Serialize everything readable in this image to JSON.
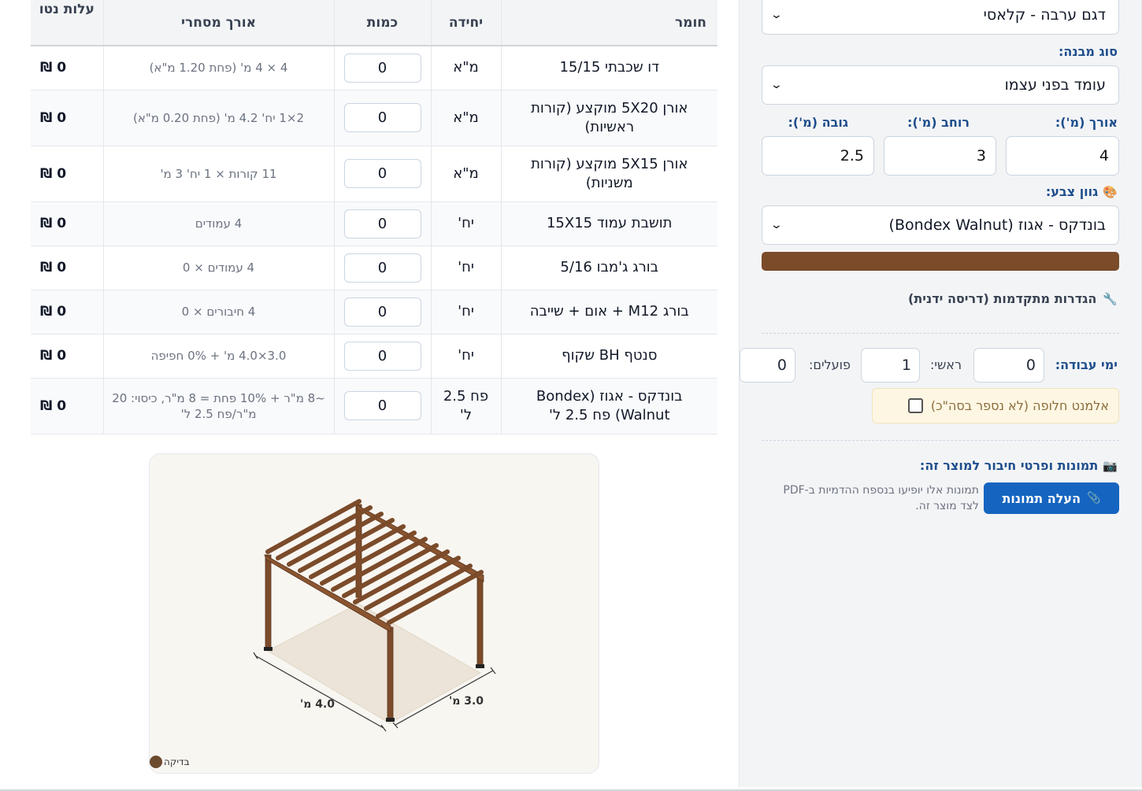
{
  "panel": {
    "model_select": "דגם ערבה - קלאסי",
    "structure_label": "סוג מבנה:",
    "structure_select": "עומד בפני עצמו",
    "length_label": "אורך (מ'):",
    "width_label": "רוחב (מ'):",
    "height_label": "גובה (מ'):",
    "length_value": "4",
    "width_value": "3",
    "height_value": "2.5",
    "color_label": "גוון צבע:",
    "color_select": "בונדקס - אגוז (Bondex Walnut)",
    "swatch_color": "#7b4b2a",
    "advanced_label": "הגדרות מתקדמות (דריסה ידנית)",
    "workdays_label": "ימי עבודה:",
    "workdays_value": "0",
    "chief_label": "ראשי:",
    "chief_value": "1",
    "workers_label": "פועלים:",
    "workers_value": "0",
    "alt_element_label": "אלמנט חלופה (לא נספר בסה\"כ)",
    "photos_title": "תמונות ופרטי חיבור למוצר זה:",
    "upload_button": "העלה תמונות",
    "upload_note": "תמונות אלו יופיעו בנספח ההדמיות ב-PDF לצד מוצר זה."
  },
  "table": {
    "headers": {
      "material": "חומר",
      "unit": "יחידה",
      "quantity": "כמות",
      "length": "אורך מסחרי",
      "cost": "עלות נטו"
    },
    "rows": [
      {
        "material": "דו שכבתי 15/15",
        "unit": "מ\"א",
        "qty": "0",
        "spec": "4 × 4 מ' (פחת 1.20 מ\"א)",
        "cost": "0 ₪"
      },
      {
        "material": "אורן 5X20 מוקצע (קורות ראשיות)",
        "unit": "מ\"א",
        "qty": "0",
        "spec": "2×1 יח' 4.2 מ' (פחת 0.20 מ\"א)",
        "cost": "0 ₪"
      },
      {
        "material": "אורן 5X15 מוקצע (קורות משניות)",
        "unit": "מ\"א",
        "qty": "0",
        "spec": "11 קורות × 1 יח' 3 מ'",
        "cost": "0 ₪"
      },
      {
        "material": "תושבת עמוד 15X15",
        "unit": "יח'",
        "qty": "0",
        "spec": "4 עמודים",
        "cost": "0 ₪"
      },
      {
        "material": "בורג ג'מבו 5/16",
        "unit": "יח'",
        "qty": "0",
        "spec": "4 עמודים × 0",
        "cost": "0 ₪"
      },
      {
        "material": "בורג M12 + אום + שייבה",
        "unit": "יח'",
        "qty": "0",
        "spec": "4 חיבורים × 0",
        "cost": "0 ₪"
      },
      {
        "material": "סנטף BH שקוף",
        "unit": "יח'",
        "qty": "0",
        "spec": "3.0×4.0 מ' + 0% חפיפה",
        "cost": "0 ₪"
      },
      {
        "material": "בונדקס - אגוז (Bondex Walnut) פח 2.5 ל'",
        "unit": "פח 2.5 ל'",
        "qty": "0",
        "spec": "~8 מ\"ר + 10% פחת = 8 מ\"ר, כיסוי: 20 מ\"ר/פח 2.5 ל'",
        "cost": "0 ₪"
      }
    ]
  },
  "preview": {
    "dim_length": "4.0 מ'",
    "dim_width": "3.0 מ'",
    "badge": "בדיקה",
    "wood_color": "#7b4b2a"
  }
}
